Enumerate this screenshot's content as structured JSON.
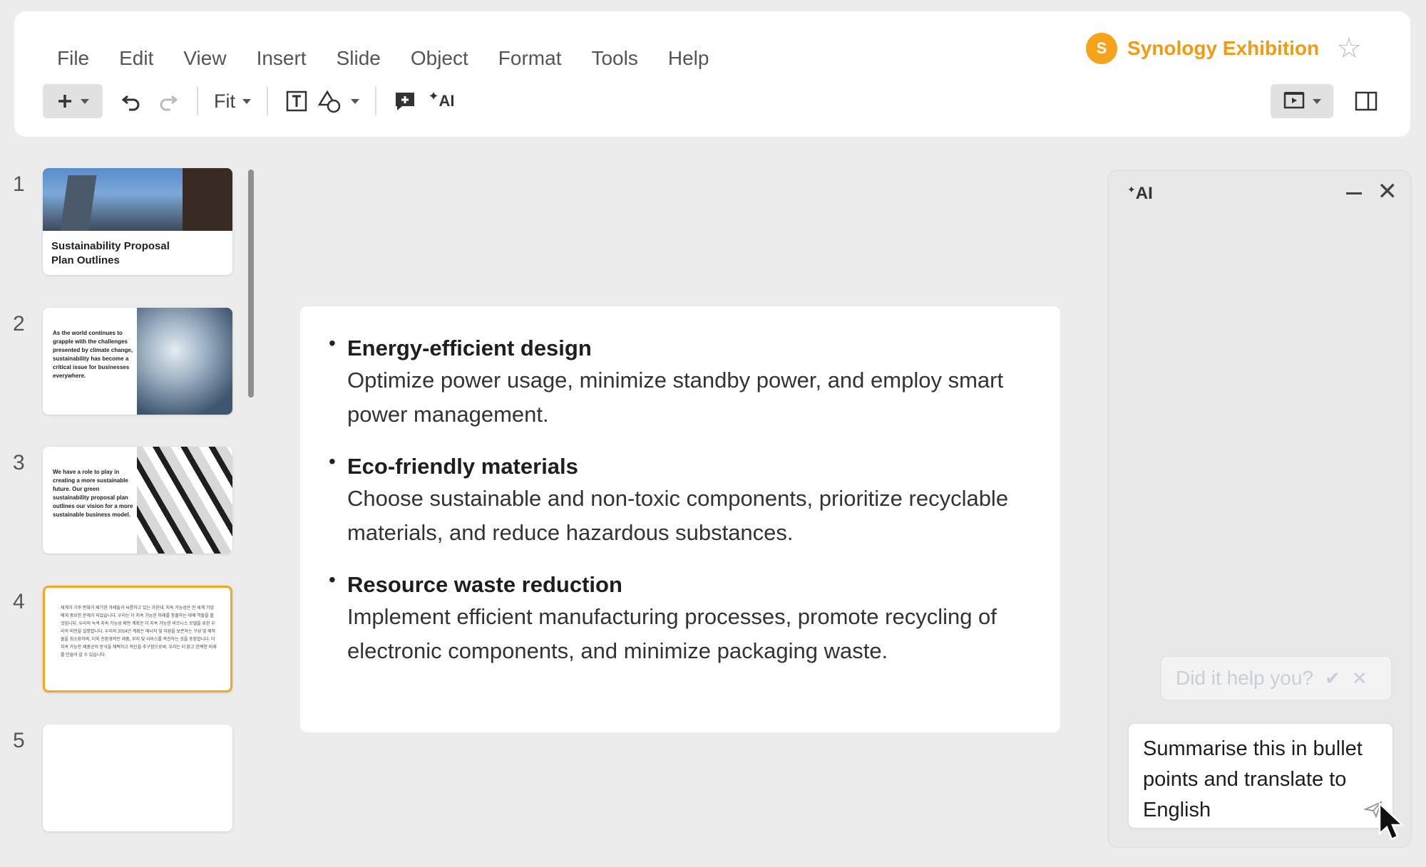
{
  "menu": [
    "File",
    "Edit",
    "View",
    "Insert",
    "Slide",
    "Object",
    "Format",
    "Tools",
    "Help"
  ],
  "document": {
    "avatar_letter": "S",
    "title": "Synology Exhibition"
  },
  "toolbar": {
    "zoom_label": "Fit",
    "ai_label": "AI"
  },
  "thumbnails": [
    {
      "number": "1",
      "caption": "Sustainability Proposal Plan Outlines"
    },
    {
      "number": "2",
      "text": "As the world continues to grapple with the challenges presented by climate change, sustainability has become a critical issue for businesses everywhere."
    },
    {
      "number": "3",
      "text": "We have a role to play in creating a more sustainable future. Our green sustainability proposal plan outlines our vision for a more sustainable business model."
    },
    {
      "number": "4",
      "text": "세계가 기후 변화가 제기한 과제들과 씨름하고 있는 가운데, 지속 가능성은 전 세계 기업에게 중요한 문제가 되었습니다. 우리는 더 지속 가능한 미래를 창출하는 데에 역할을 할 것입니다. 우리의 녹색 지속 가능성 제안 계획은 더 지속 가능한 비즈니스 모델을 위한 우리의 비전을 설명합니다. 우리의 2024년 계획은 에너지 및 자원을 보존하는 구성 및 제작물을 최소화하며, 더욱 친환경적인 제품, 부지 및 서비스를 촉진하는 것을 포함합니다. 더 지속 가능한 제품군의 방식을 채택하고 혁신을 추구함으로써, 우리는 더 밝고 윤택한 미래를 만들어 갈 수 있습니다."
    },
    {
      "number": "5"
    }
  ],
  "slide": {
    "bullets": [
      {
        "title": "Energy-efficient design",
        "desc": "Optimize power usage, minimize standby power, and employ smart power management."
      },
      {
        "title": "Eco-friendly materials",
        "desc": "Choose sustainable and non-toxic components, prioritize recyclable materials, and reduce hazardous substances."
      },
      {
        "title": "Resource waste reduction",
        "desc": "Implement efficient manufacturing processes, promote recycling of electronic components, and minimize packaging waste."
      }
    ]
  },
  "ai_panel": {
    "logo": "AI",
    "feedback_prompt": "Did it help you?",
    "prompt_text": "Summarise this in bullet points and translate to English"
  },
  "colors": {
    "accent": "#f29b12",
    "avatar": "#f7a21b",
    "active_border": "#f5a623"
  }
}
